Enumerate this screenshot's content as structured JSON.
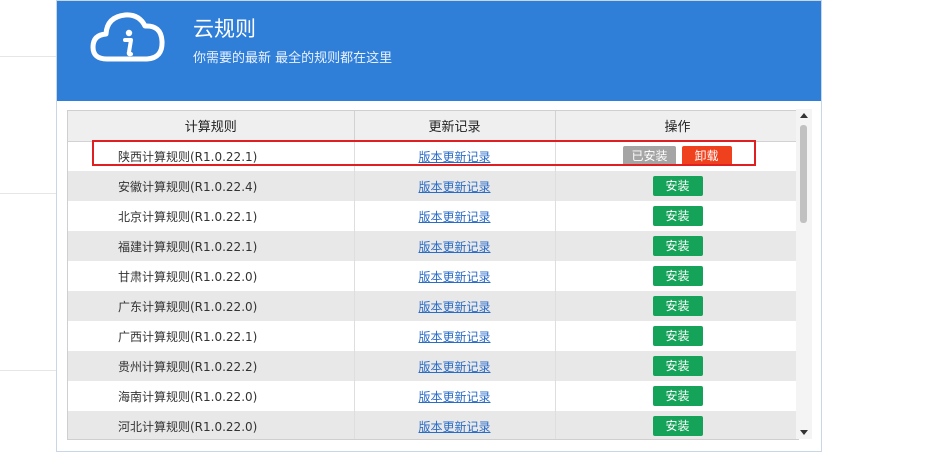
{
  "header": {
    "title": "云规则",
    "subtitle": "你需要的最新 最全的规则都在这里"
  },
  "table": {
    "columns": [
      "计算规则",
      "更新记录",
      "操作"
    ],
    "rows": [
      {
        "name": "陕西计算规则(R1.0.22.1)",
        "log": "版本更新记录",
        "status": "installed",
        "installed_label": "已安装",
        "uninstall_label": "卸载"
      },
      {
        "name": "安徽计算规则(R1.0.22.4)",
        "log": "版本更新记录",
        "action": "安装"
      },
      {
        "name": "北京计算规则(R1.0.22.1)",
        "log": "版本更新记录",
        "action": "安装"
      },
      {
        "name": "福建计算规则(R1.0.22.1)",
        "log": "版本更新记录",
        "action": "安装"
      },
      {
        "name": "甘肃计算规则(R1.0.22.0)",
        "log": "版本更新记录",
        "action": "安装"
      },
      {
        "name": "广东计算规则(R1.0.22.0)",
        "log": "版本更新记录",
        "action": "安装"
      },
      {
        "name": "广西计算规则(R1.0.22.1)",
        "log": "版本更新记录",
        "action": "安装"
      },
      {
        "name": "贵州计算规则(R1.0.22.2)",
        "log": "版本更新记录",
        "action": "安装"
      },
      {
        "name": "海南计算规则(R1.0.22.0)",
        "log": "版本更新记录",
        "action": "安装"
      },
      {
        "name": "河北计算规则(R1.0.22.0)",
        "log": "版本更新记录",
        "action": "安装"
      }
    ]
  },
  "colors": {
    "header_bg": "#2f7ed8",
    "install_button": "#15a35a",
    "installed_button": "#a5a5a5",
    "uninstall_button": "#f0411e",
    "highlight_box": "#e02020"
  },
  "icons": {
    "header_icon": "cloud-info-icon",
    "scroll_up": "triangle-up-icon",
    "scroll_down": "triangle-down-icon"
  }
}
